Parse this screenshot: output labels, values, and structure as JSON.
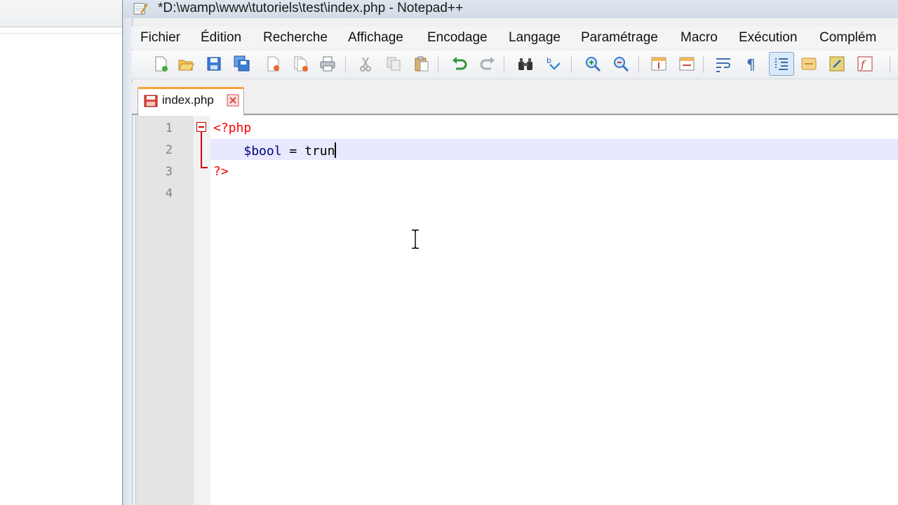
{
  "window": {
    "title": "*D:\\wamp\\www\\tutoriels\\test\\index.php - Notepad++"
  },
  "menu": [
    {
      "label": "Fichier"
    },
    {
      "label": "Édition"
    },
    {
      "label": "Recherche"
    },
    {
      "label": "Affichage"
    },
    {
      "label": "Encodage"
    },
    {
      "label": "Langage"
    },
    {
      "label": "Paramétrage"
    },
    {
      "label": "Macro"
    },
    {
      "label": "Exécution"
    },
    {
      "label": "Complém"
    }
  ],
  "toolbar": {
    "icons": [
      "new-file-icon",
      "open-file-icon",
      "save-icon",
      "save-all-icon",
      "close-icon",
      "close-all-icon",
      "print-icon",
      "cut-icon",
      "copy-icon",
      "paste-icon",
      "undo-icon",
      "redo-icon",
      "find-icon",
      "replace-icon",
      "zoom-in-icon",
      "zoom-out-icon",
      "sync-vertical-icon",
      "sync-horizontal-icon",
      "word-wrap-icon",
      "show-all-chars-icon",
      "indent-guide-icon",
      "user-lang-icon",
      "function-list-icon",
      "macro-record-icon"
    ]
  },
  "tab": {
    "label": "index.php",
    "modified": true
  },
  "editor": {
    "line_numbers": [
      "1",
      "2",
      "3",
      "4"
    ],
    "lines": [
      {
        "tag": "<?php"
      },
      {
        "indent": "    ",
        "var": "$bool",
        "op": " = ",
        "word": "trun"
      },
      {
        "tag": "?>"
      },
      {}
    ]
  },
  "colors": {
    "tag": "#ff0000",
    "current_line": "#e8e8ff",
    "tab_accent": "#f6a23c"
  }
}
